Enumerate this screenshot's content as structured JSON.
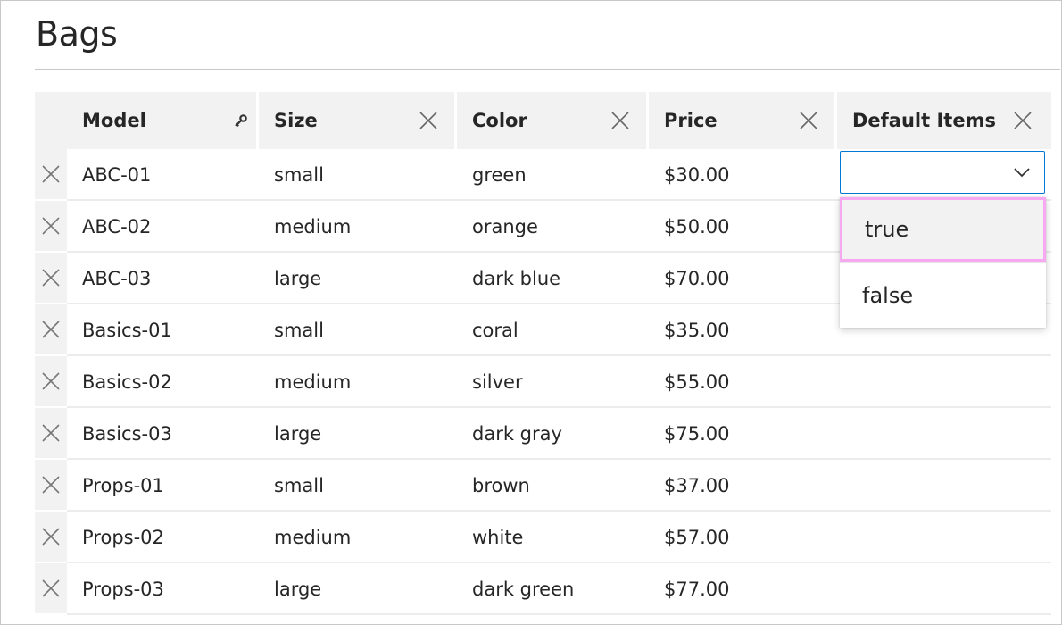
{
  "page": {
    "title": "Bags"
  },
  "grid": {
    "columns": [
      {
        "label": "Model",
        "action_icon": "key-icon"
      },
      {
        "label": "Size",
        "action_icon": "close-icon"
      },
      {
        "label": "Color",
        "action_icon": "close-icon"
      },
      {
        "label": "Price",
        "action_icon": "close-icon"
      },
      {
        "label": "Default Items",
        "action_icon": "close-icon"
      }
    ],
    "rows": [
      {
        "model": "ABC-01",
        "size": "small",
        "color": "green",
        "price": "$30.00"
      },
      {
        "model": "ABC-02",
        "size": "medium",
        "color": "orange",
        "price": "$50.00"
      },
      {
        "model": "ABC-03",
        "size": "large",
        "color": "dark blue",
        "price": "$70.00"
      },
      {
        "model": "Basics-01",
        "size": "small",
        "color": "coral",
        "price": "$35.00"
      },
      {
        "model": "Basics-02",
        "size": "medium",
        "color": "silver",
        "price": "$55.00"
      },
      {
        "model": "Basics-03",
        "size": "large",
        "color": "dark gray",
        "price": "$75.00"
      },
      {
        "model": "Props-01",
        "size": "small",
        "color": "brown",
        "price": "$37.00"
      },
      {
        "model": "Props-02",
        "size": "medium",
        "color": "white",
        "price": "$57.00"
      },
      {
        "model": "Props-03",
        "size": "large",
        "color": "dark green",
        "price": "$77.00"
      }
    ]
  },
  "dropdown": {
    "value": "",
    "options": [
      "true",
      "false"
    ],
    "highlighted_index": 0
  },
  "colors": {
    "focus_border": "#0078d4",
    "highlight_border": "#f6a8f0",
    "header_bg": "#f2f2f2"
  }
}
